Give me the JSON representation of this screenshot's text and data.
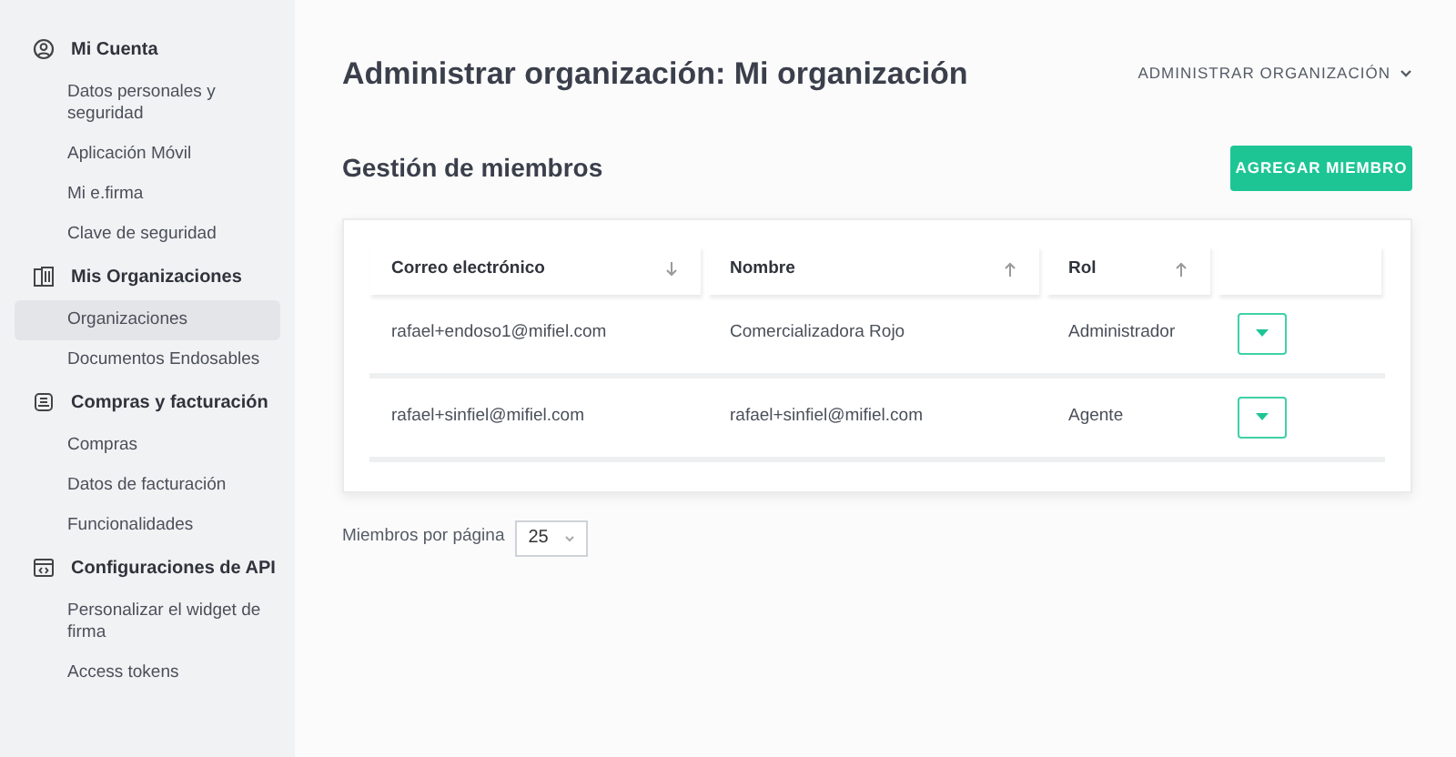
{
  "sidebar": {
    "sections": [
      {
        "kind": "user",
        "title": "Mi Cuenta",
        "items": [
          {
            "label": "Datos personales y seguridad",
            "selected": false
          },
          {
            "label": "Aplicación Móvil",
            "selected": false
          },
          {
            "label": "Mi e.firma",
            "selected": false
          },
          {
            "label": "Clave de seguridad",
            "selected": false
          }
        ]
      },
      {
        "kind": "building",
        "title": "Mis Organizaciones",
        "items": [
          {
            "label": "Organizaciones",
            "selected": true
          },
          {
            "label": "Documentos Endosables",
            "selected": false
          }
        ]
      },
      {
        "kind": "receipt",
        "title": "Compras y facturación",
        "items": [
          {
            "label": "Compras",
            "selected": false
          },
          {
            "label": "Datos de facturación",
            "selected": false
          },
          {
            "label": "Funcionalidades",
            "selected": false
          }
        ]
      },
      {
        "kind": "code",
        "title": "Configuraciones de API",
        "items": [
          {
            "label": "Personalizar el widget de firma",
            "selected": false
          },
          {
            "label": "Access tokens",
            "selected": false
          }
        ]
      }
    ]
  },
  "page_title": "Administrar organización: Mi organización",
  "admin_menu": "ADMINISTRAR ORGANIZACIÓN",
  "section_title": "Gestión de miembros",
  "add_button": "AGREGAR MIEMBRO",
  "table": {
    "columns": [
      {
        "label": "Correo electrónico",
        "sortable": true,
        "descending": true
      },
      {
        "label": "Nombre",
        "sortable": true,
        "descending": false
      },
      {
        "label": "Rol",
        "sortable": true,
        "descending": false
      },
      {
        "sortable": false
      }
    ],
    "rows": [
      {
        "email": "rafael+endoso1@mifiel.com",
        "name": "Comercializadora Rojo",
        "role": "Administrador"
      },
      {
        "email": "rafael+sinfiel@mifiel.com",
        "name": "rafael+sinfiel@mifiel.com",
        "role": "Agente"
      }
    ]
  },
  "pagination": {
    "label": "Miembros por página",
    "value": "25"
  }
}
